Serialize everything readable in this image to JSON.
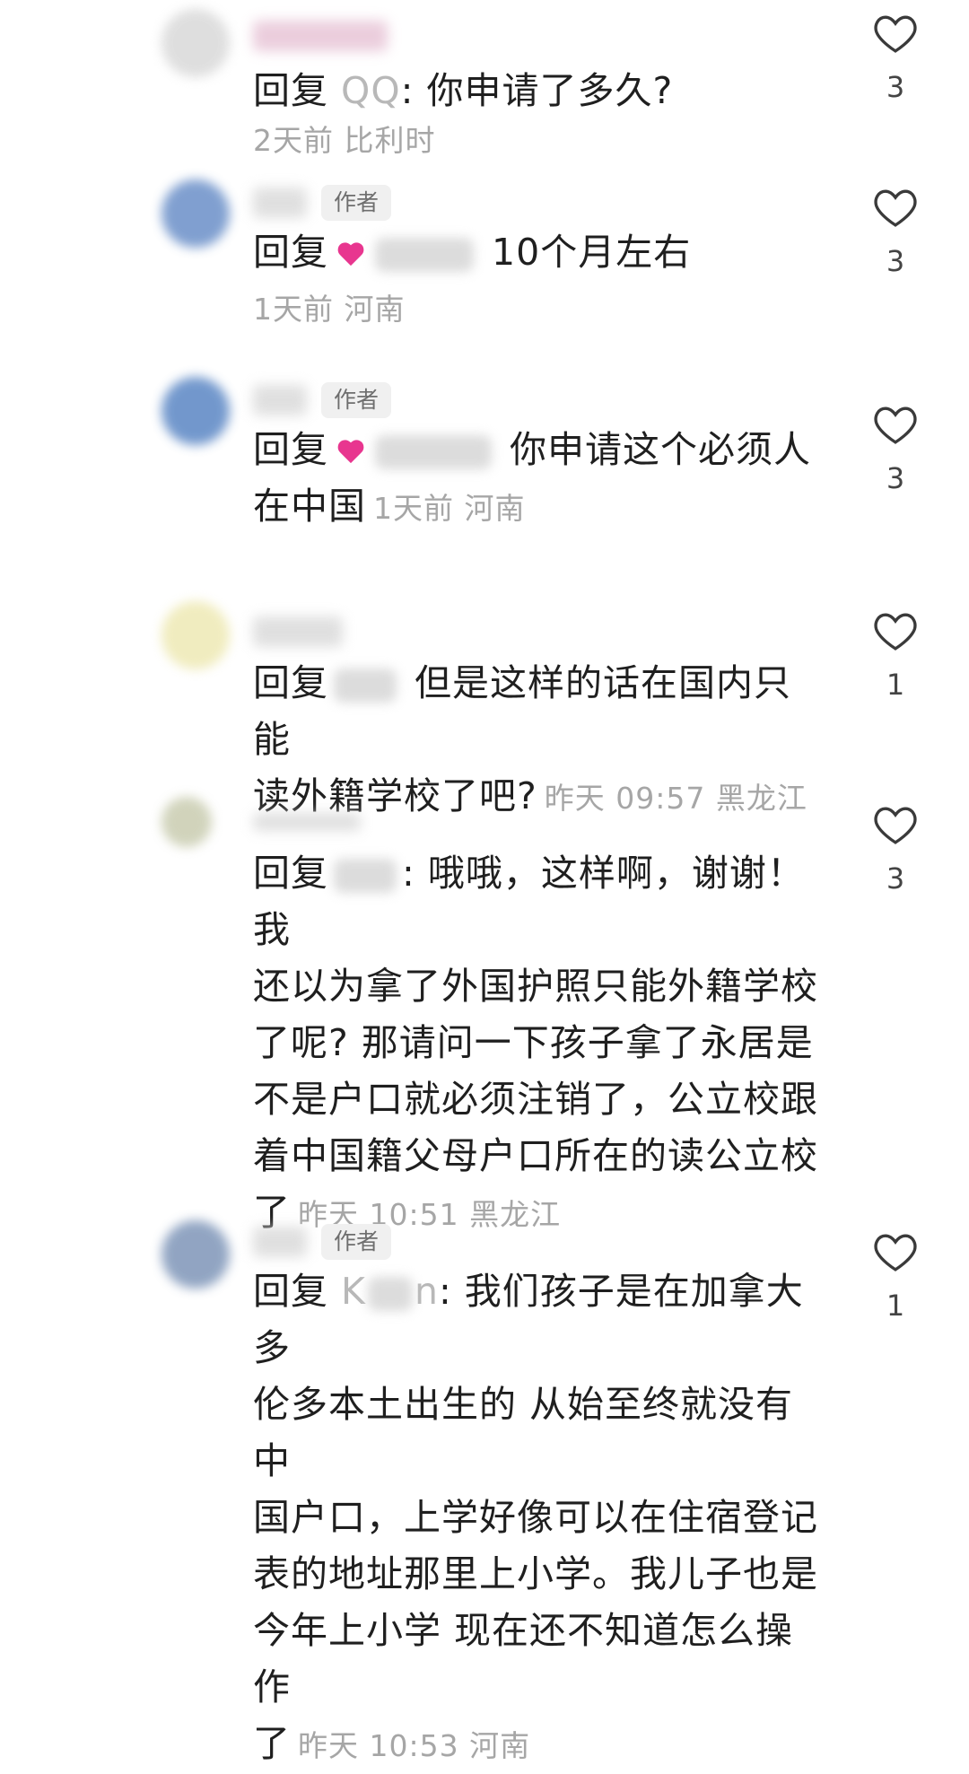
{
  "comments": [
    {
      "reply_prefix": "回复",
      "mention": "QQ",
      "text": ": 你申请了多久?",
      "meta": "2天前 比利时",
      "likes": "3",
      "is_author": false,
      "avatar_color": "#d9d9d9"
    },
    {
      "reply_prefix": "回复",
      "mention": "",
      "text": "10个月左右",
      "meta": "1天前 河南",
      "likes": "3",
      "is_author": true,
      "author_label": "作者",
      "avatar_color": "#6a8fc8"
    },
    {
      "reply_prefix": "回复",
      "mention": "",
      "text_line1": "你申请这个必须人",
      "text_line2": "在中国",
      "meta": "1天前 河南",
      "likes": "3",
      "is_author": true,
      "author_label": "作者",
      "avatar_color": "#5a86c4"
    },
    {
      "reply_prefix": "回复",
      "mention": "",
      "text_line1": "但是这样的话在国内只能",
      "text_line2": "读外籍学校了吧?",
      "meta": "昨天 09:57 黑龙江",
      "likes": "1",
      "is_author": false,
      "avatar_color": "#eee9b4"
    },
    {
      "reply_prefix": "回复",
      "mention": "",
      "text_line1": ": 哦哦，这样啊，谢谢！我",
      "text_line2": "还以为拿了外国护照只能外籍学校",
      "text_line3": "了呢? 那请问一下孩子拿了永居是",
      "text_line4": "不是户口就必须注销了，公立校跟",
      "text_line5": "着中国籍父母户口所在的读公立校",
      "text_line6": "了",
      "meta": "昨天 10:51 黑龙江",
      "likes": "3",
      "is_author": false,
      "avatar_color": "#c9ccb0"
    },
    {
      "reply_prefix": "回复",
      "mention": "K",
      "mention_tail": "n",
      "text_line1": ": 我们孩子是在加拿大多",
      "text_line2": "伦多本土出生的 从始至终就没有中",
      "text_line3": "国户口，上学好像可以在住宿登记",
      "text_line4": "表的地址那里上小学。我儿子也是",
      "text_line5": "今年上小学 现在还不知道怎么操作",
      "text_line6": "了",
      "meta": "昨天 10:53 河南",
      "likes": "1",
      "is_author": true,
      "author_label": "作者",
      "avatar_color": "#7e95b8"
    }
  ],
  "icons": {
    "like": "heart-outline-icon",
    "emoji": "pink-heart-emoji-icon"
  },
  "colors": {
    "text": "#1f1f1f",
    "meta": "#a6a6a6",
    "mention": "#b8b8b8",
    "emoji": "#e8368f"
  }
}
